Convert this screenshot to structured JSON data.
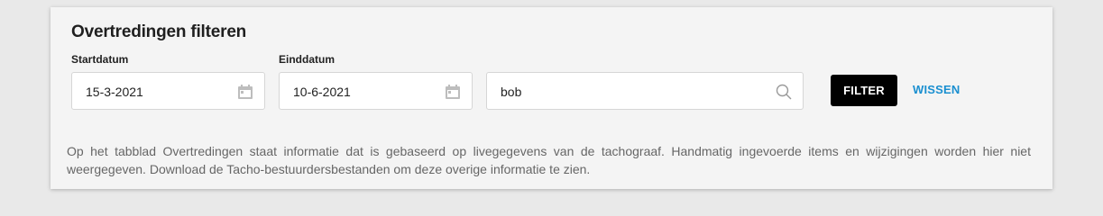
{
  "filter_panel": {
    "title": "Overtredingen filteren",
    "start_date": {
      "label": "Startdatum",
      "value": "15-3-2021",
      "icon": "calendar-icon"
    },
    "end_date": {
      "label": "Einddatum",
      "value": "10-6-2021",
      "icon": "calendar-icon"
    },
    "search": {
      "value": "bob",
      "icon": "search-icon"
    },
    "filter_button": "FILTER",
    "clear_button": "WISSEN",
    "info_text": "Op het tabblad Overtredingen staat informatie dat is gebaseerd op livegegevens van de tachograaf. Handmatig ingevoerde items en wijzigingen worden hier niet weergegeven. Download de Tacho-bestuurdersbestanden om deze overige informatie te zien."
  },
  "colors": {
    "accent_link": "#1a8fd0",
    "button_bg": "#000000",
    "panel_bg": "#f4f4f4",
    "page_bg": "#e9e9e9"
  }
}
